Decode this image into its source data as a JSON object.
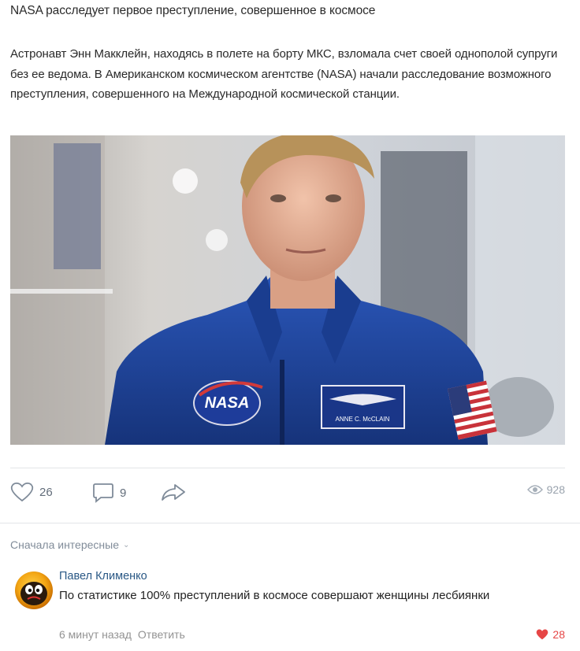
{
  "post": {
    "title": "NASA расследует первое преступление, совершенное в космосе",
    "body": "Астронавт Энн Макклейн, находясь в полете на борту МКС, взломала счет своей однополой супруги без ее ведома. В Американском космическом агентстве (NASA) начали расследование возможного преступления, совершенного на Международной космической станции.",
    "image_alt": "Астронавт в синем комбинезоне NASA",
    "badge_text": "NASA",
    "name_tag": "ANNE C. McCLAIN"
  },
  "actions": {
    "likes": "26",
    "comments": "9",
    "views": "928",
    "icons": [
      "heart-icon",
      "comment-icon",
      "share-icon",
      "eye-icon"
    ]
  },
  "comments_section": {
    "sort_label": "Сначала интересные",
    "items": [
      {
        "author": "Павел Клименко",
        "text": "По статистике 100% преступлений в космосе совершают женщины лесбиянки",
        "time": "6 минут назад",
        "reply_label": "Ответить",
        "likes": "28"
      }
    ]
  },
  "colors": {
    "link": "#2a5885",
    "muted": "#818c99",
    "like_red": "#e64646",
    "suit_blue": "#1d3f8f"
  }
}
